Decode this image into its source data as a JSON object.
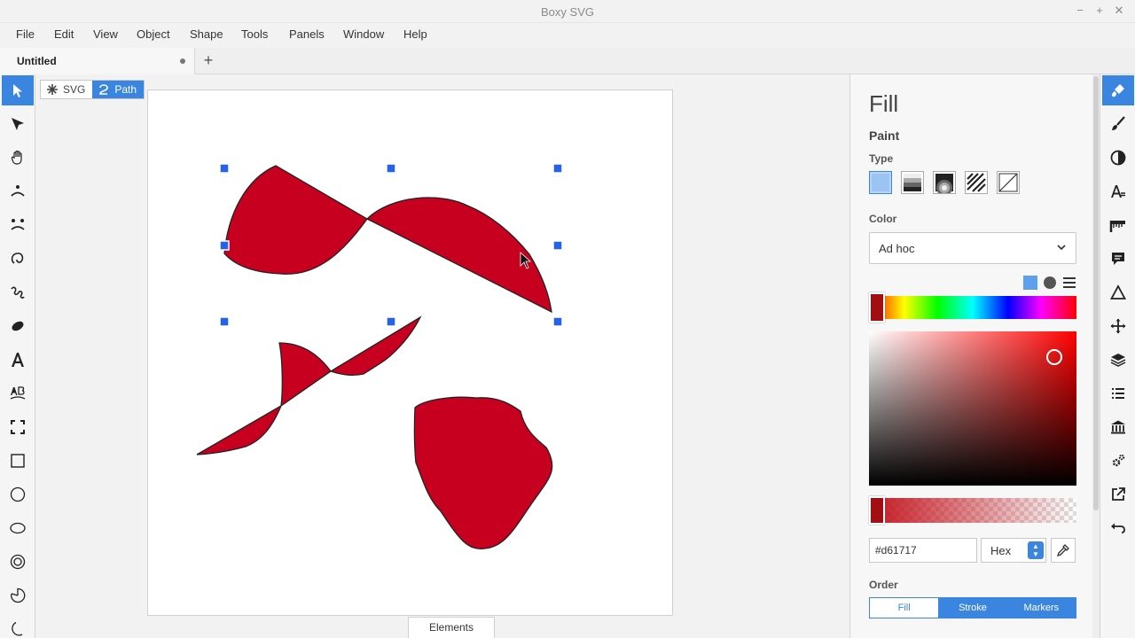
{
  "window": {
    "title": "Boxy SVG",
    "controls": [
      "−",
      "+",
      "✕"
    ]
  },
  "menu": [
    "File",
    "Edit",
    "View",
    "Object",
    "Shape",
    "Tools",
    "Panels",
    "Window",
    "Help"
  ],
  "tabs": {
    "document": "Untitled",
    "add": "+"
  },
  "left_tools": [
    "select-tool-icon",
    "edit-tool-icon",
    "pan-tool-icon",
    "pencil-tool-icon",
    "bezier-tool-icon",
    "spiral-tool-icon",
    "freehand-tool-icon",
    "blob-tool-icon",
    "text-tool-icon",
    "textpath-tool-icon",
    "crop-tool-icon",
    "rect-tool-icon",
    "circle-tool-icon",
    "ellipse-tool-icon",
    "ring-tool-icon",
    "pie-tool-icon",
    "crescent-tool-icon"
  ],
  "mode_switch": {
    "svg": "SVG",
    "path": "Path"
  },
  "elements_tab": "Elements",
  "fill_color": "#c8001f",
  "panel": {
    "title": "Fill",
    "section": "Paint",
    "type_label": "Type",
    "color_label": "Color",
    "color_value": "Ad hoc",
    "hex_value": "#d61717",
    "format_value": "Hex",
    "order_label": "Order",
    "order_tabs": [
      "Fill",
      "Stroke",
      "Markers"
    ]
  },
  "right_tools": [
    "fill-panel-icon",
    "stroke-panel-icon",
    "contrast-panel-icon",
    "typography-panel-icon",
    "ruler-panel-icon",
    "comment-panel-icon",
    "geometry-panel-icon",
    "transform-panel-icon",
    "layers-panel-icon",
    "list-panel-icon",
    "library-panel-icon",
    "generators-panel-icon",
    "export-panel-icon",
    "undo-panel-icon"
  ]
}
